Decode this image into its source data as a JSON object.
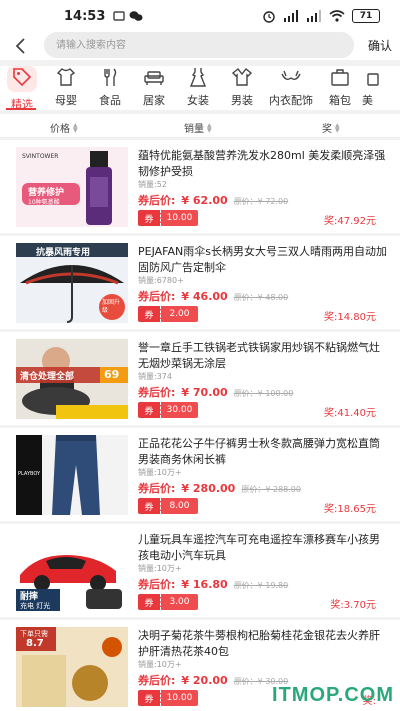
{
  "status": {
    "time": "14:53",
    "battery": "71"
  },
  "search": {
    "placeholder": "请输入搜索内容",
    "confirm_label": "确认"
  },
  "categories": [
    {
      "label": "精选",
      "icon": "tag-icon"
    },
    {
      "label": "母婴",
      "icon": "baby-clothes-icon"
    },
    {
      "label": "食品",
      "icon": "cutlery-icon"
    },
    {
      "label": "居家",
      "icon": "sofa-icon"
    },
    {
      "label": "女装",
      "icon": "dress-icon"
    },
    {
      "label": "男装",
      "icon": "shirt-icon"
    },
    {
      "label": "内衣配饰",
      "icon": "bra-icon"
    },
    {
      "label": "箱包",
      "icon": "bag-icon"
    },
    {
      "label": "美",
      "icon": "beauty-icon"
    }
  ],
  "sort": {
    "price": "价格",
    "sales": "销量",
    "reward": "奖"
  },
  "products": [
    {
      "title": "蕴特优能氨基酸营养洗发水280ml 美发柔顺亮泽强韧修护受损",
      "sales": "销量:52",
      "price_label": "券后价:",
      "price": "¥ 62.00",
      "orig": "原价：¥ 72.00",
      "coupon_tag": "券",
      "coupon_value": "10.00",
      "reward": "奖:47.92元",
      "thumb_text": [
        "SVINTOWER",
        "营养修护",
        "10种氨基酸"
      ]
    },
    {
      "title": "PEJAFAN雨伞s长柄男女大号三双人晴雨两用自动加固防风广告定制伞",
      "sales": "销量:6780+",
      "price_label": "券后价:",
      "price": "¥ 46.00",
      "orig": "原价：¥ 48.00",
      "coupon_tag": "券",
      "coupon_value": "2.00",
      "reward": "奖:14.80元",
      "thumb_text": [
        "抗暴风雨专用",
        "加固升级"
      ]
    },
    {
      "title": "誉一章丘手工铁锅老式铁锅家用炒锅不粘锅燃气灶无烟炒菜锅无涂层",
      "sales": "销量:374",
      "price_label": "券后价:",
      "price": "¥ 70.00",
      "orig": "原价：¥ 100.00",
      "coupon_tag": "券",
      "coupon_value": "30.00",
      "reward": "奖:41.40元",
      "thumb_text": [
        "清仓处理全部",
        "69"
      ]
    },
    {
      "title": "正品花花公子牛仔裤男士秋冬款高腰弹力宽松直筒男装商务休闲长裤",
      "sales": "销量:10万+",
      "price_label": "券后价:",
      "price": "¥ 280.00",
      "orig": "原价：¥ 288.00",
      "coupon_tag": "券",
      "coupon_value": "8.00",
      "reward": "奖:18.65元",
      "thumb_text": [
        "PLAYBOY"
      ]
    },
    {
      "title": "儿童玩具车遥控汽车可充电遥控车漂移赛车小孩男孩电动小汽车玩具",
      "sales": "销量:10万+",
      "price_label": "券后价:",
      "price": "¥ 16.80",
      "orig": "原价：¥ 19.80",
      "coupon_tag": "券",
      "coupon_value": "3.00",
      "reward": "奖:3.70元",
      "thumb_text": [
        "耐摔",
        "充电 灯光"
      ]
    },
    {
      "title": "决明子菊花茶牛蒡根枸杞胎菊桂花金银花去火养肝护肝清热花茶40包",
      "sales": "销量:10万+",
      "price_label": "券后价:",
      "price": "¥ 20.00",
      "orig": "原价：¥ 30.00",
      "coupon_tag": "券",
      "coupon_value": "10.00",
      "reward": "奖:",
      "thumb_text": [
        "下单只需",
        "8.7"
      ]
    }
  ],
  "watermark": "ITMOP.COM",
  "colors": {
    "accent": "#e8383d",
    "watermark": "#2aa87a"
  }
}
